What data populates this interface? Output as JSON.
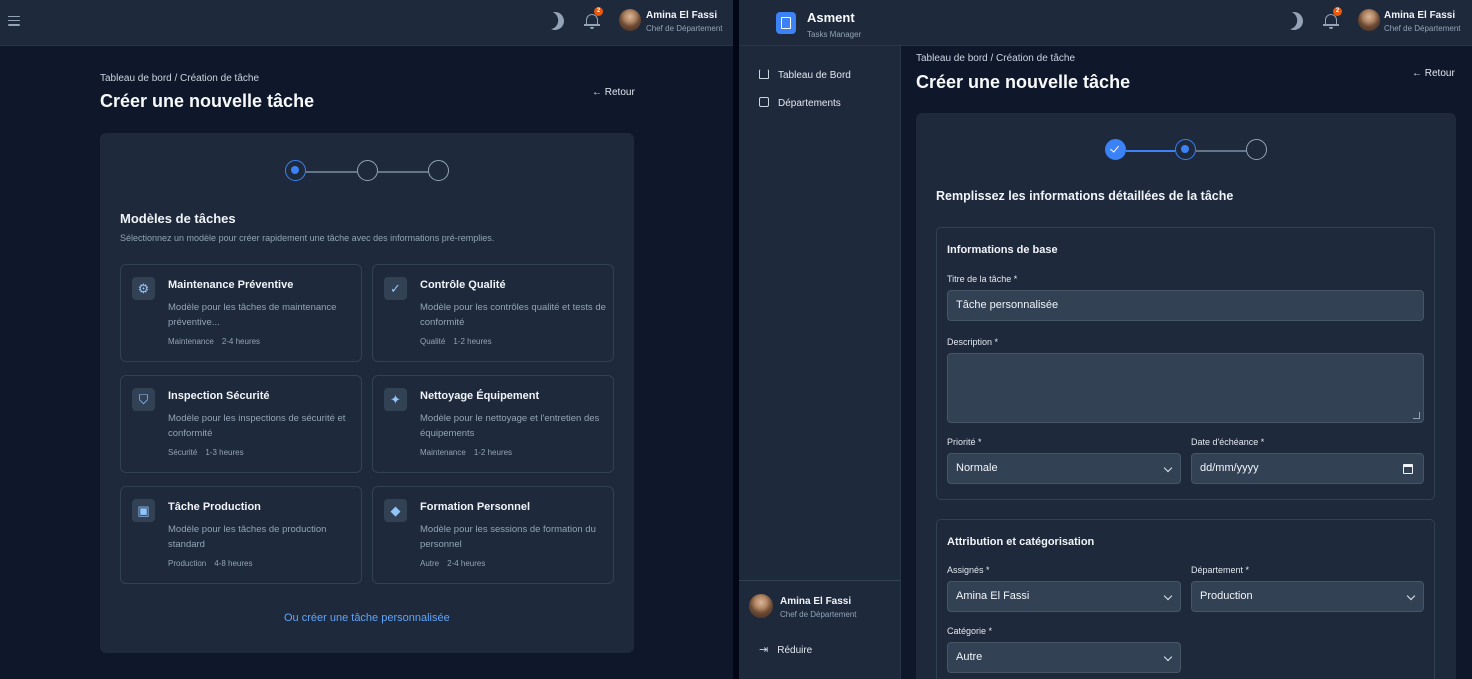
{
  "header": {
    "user_name": "Amina El Fassi",
    "user_role": "Chef de Département",
    "notif_count": "2"
  },
  "sidebar": {
    "brand": "Asment",
    "brand_sub": "Tasks Manager",
    "items": [
      {
        "label": "Tableau de Bord",
        "icon": "home-icon"
      },
      {
        "label": "Départements",
        "icon": "building-icon"
      }
    ],
    "user_name": "Amina El Fassi",
    "user_role": "Chef de Département",
    "collapse_label": "Réduire"
  },
  "page": {
    "breadcrumb": "Tableau de bord / Création de tâche",
    "title": "Créer une nouvelle tâche",
    "back_label": "← Retour"
  },
  "templates_step": {
    "heading": "Modèles de tâches",
    "subheading": "Sélectionnez un modèle pour créer rapidement une tâche avec des informations pré-remplies.",
    "templates": [
      {
        "title": "Maintenance Préventive",
        "desc": "Modèle pour les tâches de maintenance préventive...",
        "category": "Maintenance",
        "duration": "2-4 heures",
        "icon": "gear-icon"
      },
      {
        "title": "Contrôle Qualité",
        "desc": "Modèle pour les contrôles qualité et tests de conformité",
        "category": "Qualité",
        "duration": "1-2 heures",
        "icon": "check-icon"
      },
      {
        "title": "Inspection Sécurité",
        "desc": "Modèle pour les inspections de sécurité et conformité",
        "category": "Sécurité",
        "duration": "1-3 heures",
        "icon": "shield-icon"
      },
      {
        "title": "Nettoyage Équipement",
        "desc": "Modèle pour le nettoyage et l'entretien des équipements",
        "category": "Maintenance",
        "duration": "1-2 heures",
        "icon": "sparkles-icon"
      },
      {
        "title": "Tâche Production",
        "desc": "Modèle pour les tâches de production standard",
        "category": "Production",
        "duration": "4-8 heures",
        "icon": "briefcase-icon"
      },
      {
        "title": "Formation Personnel",
        "desc": "Modèle pour les sessions de formation du personnel",
        "category": "Autre",
        "duration": "2-4 heures",
        "icon": "graduation-cap-icon"
      }
    ],
    "custom_link": "Ou créer une tâche personnalisée"
  },
  "details_step": {
    "heading": "Remplissez les informations détaillées de la tâche",
    "basic": {
      "title": "Informations de base",
      "title_label": "Titre de la tâche *",
      "title_value": "Tâche personnalisée",
      "description_label": "Description *",
      "description_value": "",
      "priority_label": "Priorité *",
      "priority_value": "Normale",
      "due_label": "Date d'échéance *",
      "due_placeholder": "dd/mm/yyyy"
    },
    "assignment": {
      "title": "Attribution et catégorisation",
      "assignees_label": "Assignés *",
      "assignees_value": "Amina El Fassi",
      "department_label": "Département *",
      "department_value": "Production",
      "category_label": "Catégorie *",
      "category_value": "Autre"
    }
  },
  "colors": {
    "accent": "#3b82f6",
    "background": "#0f172a",
    "surface": "#1e293b",
    "badge": "#ea580c"
  }
}
